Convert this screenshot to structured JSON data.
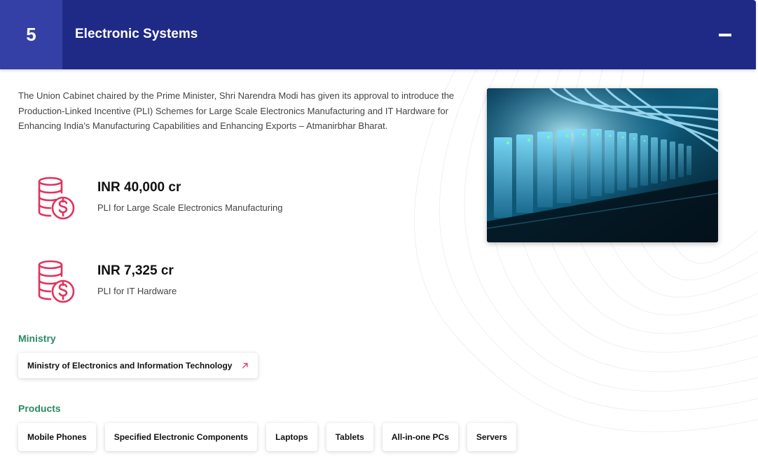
{
  "header": {
    "number": "5",
    "title": "Electronic Systems"
  },
  "intro": {
    "text": "The Union Cabinet chaired by the Prime Minister, Shri Narendra Modi has given its approval to introduce the Production-Linked Incentive (PLI) Schemes for Large Scale Electronics Manufacturing and IT Hardware for Enhancing India’s Manufacturing Capabilities and Enhancing Exports – Atmanirbhar Bharat."
  },
  "stats": [
    {
      "amount": "INR 40,000 cr",
      "description": "PLI for Large Scale Electronics Manufacturing",
      "icon": "coins-dollar-icon"
    },
    {
      "amount": "INR 7,325 cr",
      "description": "PLI for IT Hardware",
      "icon": "coins-dollar-icon"
    }
  ],
  "ministry": {
    "label": "Ministry",
    "name": "Ministry of Electronics and Information Technology",
    "icon": "external-arrow-icon"
  },
  "products": {
    "label": "Products",
    "items": [
      "Mobile Phones",
      "Specified Electronic Components",
      "Laptops",
      "Tablets",
      "All-in-one PCs",
      "Servers"
    ]
  },
  "colors": {
    "header_bg": "#1f2a86",
    "number_bg": "#3540a6",
    "accent_green": "#2a8a64",
    "icon_pink": "#e0345f"
  }
}
